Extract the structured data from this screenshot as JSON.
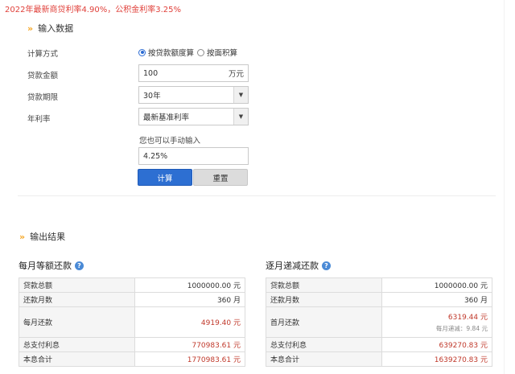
{
  "notice": "2022年最新商贷利率4.90%，公积金利率3.25%",
  "input_section": {
    "title": "输入数据",
    "calc_method_label": "计算方式",
    "calc_options": [
      "按贷款额度算",
      "按面积算"
    ],
    "selected_calc_option": "按贷款额度算",
    "loan_amount_label": "贷款金额",
    "loan_amount_value": "100",
    "loan_amount_unit": "万元",
    "loan_term_label": "贷款期限",
    "loan_term_value": "30年",
    "rate_label": "年利率",
    "rate_select_value": "最新基准利率",
    "manual_hint": "您也可以手动输入",
    "manual_rate_value": "4.25%",
    "calc_button": "计算",
    "reset_button": "重置"
  },
  "output_section": {
    "title": "输出结果",
    "equal_payment": {
      "title": "每月等额还款",
      "rows": [
        {
          "label": "贷款总额",
          "value": "1000000.00 元"
        },
        {
          "label": "还款月数",
          "value": "360 月"
        },
        {
          "label": "每月还款",
          "value": "4919.40 元"
        },
        {
          "label": "总支付利息",
          "value": "770983.61 元"
        },
        {
          "label": "本息合计",
          "value": "1770983.61 元"
        }
      ]
    },
    "decreasing_payment": {
      "title": "逐月递减还款",
      "rows": [
        {
          "label": "贷款总额",
          "value": "1000000.00 元"
        },
        {
          "label": "还款月数",
          "value": "360 月"
        },
        {
          "label": "首月还款",
          "value": "6319.44 元",
          "note": "每月递减：9.84 元"
        },
        {
          "label": "总支付利息",
          "value": "639270.83 元"
        },
        {
          "label": "本息合计",
          "value": "1639270.83 元"
        }
      ]
    }
  },
  "icons": {
    "section_chevron": "double-chevron-right-icon",
    "help": "question-circle-icon",
    "select_arrow": "triangle-down-icon"
  },
  "colors": {
    "notice_red": "#e0403a",
    "accent_orange": "#f5a623",
    "button_blue": "#2d6fd2",
    "value_red": "#c0392b"
  }
}
